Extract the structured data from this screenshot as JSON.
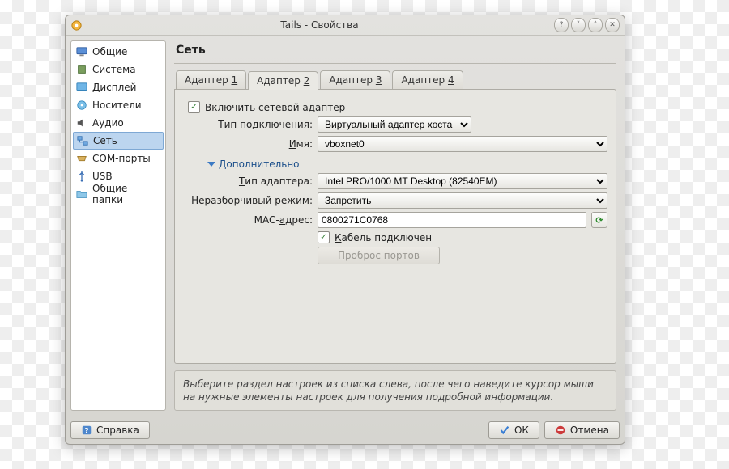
{
  "window": {
    "title": "Tails - Свойства"
  },
  "sidebar": {
    "items": [
      {
        "label": "Общие"
      },
      {
        "label": "Система"
      },
      {
        "label": "Дисплей"
      },
      {
        "label": "Носители"
      },
      {
        "label": "Аудио"
      },
      {
        "label": "Сеть"
      },
      {
        "label": "COM-порты"
      },
      {
        "label": "USB"
      },
      {
        "label": "Общие папки"
      }
    ],
    "selected_index": 5
  },
  "page": {
    "title": "Сеть"
  },
  "tabs": [
    {
      "label_prefix": "Адаптер ",
      "hotkey": "1"
    },
    {
      "label_prefix": "Адаптер ",
      "hotkey": "2"
    },
    {
      "label_prefix": "Адаптер ",
      "hotkey": "3"
    },
    {
      "label_prefix": "Адаптер ",
      "hotkey": "4"
    }
  ],
  "active_tab_index": 1,
  "fields": {
    "enable_adapter": {
      "label_pre": "",
      "label_u": "В",
      "label_post": "ключить сетевой адаптер",
      "checked": true
    },
    "attached": {
      "label_pre": "Тип ",
      "label_u": "п",
      "label_post": "одключения:",
      "value": "Виртуальный адаптер хоста"
    },
    "name": {
      "label_pre": "",
      "label_u": "И",
      "label_post": "мя:",
      "value": "vboxnet0"
    },
    "advanced": {
      "label_pre": "",
      "label_u": "Д",
      "label_post": "ополнительно"
    },
    "adapter_type": {
      "label_pre": "",
      "label_u": "Т",
      "label_post": "ип адаптера:",
      "value": "Intel PRO/1000 MT Desktop (82540EM)"
    },
    "promiscuous": {
      "label_pre": "",
      "label_u": "Н",
      "label_post": "еразборчивый режим:",
      "value": "Запретить"
    },
    "mac": {
      "label_pre": "MAC-",
      "label_u": "а",
      "label_post": "дрес:",
      "value": "0800271C0768"
    },
    "cable": {
      "label_pre": "",
      "label_u": "К",
      "label_post": "абель подключен",
      "checked": true
    },
    "port_forward": {
      "label": "Проброс портов"
    }
  },
  "hint": "Выберите раздел настроек из списка слева, после чего наведите курсор мыши на нужные элементы настроек для получения подробной информации.",
  "buttons": {
    "help": "Справка",
    "ok": "ОК",
    "cancel": "Отмена"
  }
}
